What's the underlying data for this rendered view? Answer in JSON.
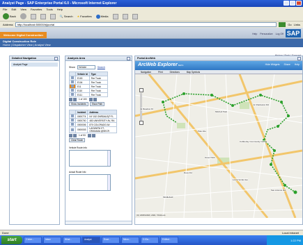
{
  "window": {
    "title": "Analyst Page - SAP Enterprise Portal 6.0 - Microsoft Internet Explorer"
  },
  "menu": [
    "File",
    "Edit",
    "View",
    "Favorites",
    "Tools",
    "Help"
  ],
  "toolbar": {
    "back": "Back",
    "search": "Search",
    "favorites": "Favorites",
    "media": "Media"
  },
  "address": {
    "label": "Address",
    "value": "http://localhost:50000/irj/portal",
    "go": "Go",
    "links": "Links"
  },
  "portal": {
    "welcome": "Welcome Digital Construction",
    "header_links": [
      "Help",
      "Personalize",
      "Log Off"
    ],
    "logo": "SAP",
    "crumb_title": "Digital Construction Role",
    "crumb_path": "Home | Dispatcher View | Analyst View",
    "history": "History | Back | Forward"
  },
  "detailed_nav": {
    "title": "Detailed Navigation",
    "item": "Analyst Page"
  },
  "analysis": {
    "title": "Analysis Area",
    "show_label": "Show",
    "show_value": "Vehicle",
    "search": "Search",
    "vehicle_headers": [
      "Vehicle Id",
      "Type"
    ],
    "vehicles": [
      [
        "E100",
        "Fire Truck"
      ],
      [
        "E104",
        "Fire Truck"
      ],
      [
        "E11",
        "Fire Truck"
      ],
      [
        "E110",
        "Fire Truck"
      ],
      [
        "E111",
        "Fire Truck"
      ]
    ],
    "vehicle_pager": "1 of 100",
    "vehicle_buttons": [
      "Show Incidents",
      "Show Path"
    ],
    "incident_headers": [
      "Incident",
      "Address"
    ],
    "incidents": [
      [
        "0000774",
        "NY 152 ONRDALE(P FL"
      ],
      [
        "0000700",
        "483 UNIVERSITY AV, RA"
      ],
      [
        "0000006",
        "870 COLORADO AV"
      ],
      [
        "0000003",
        "LAGUNITA CT-GRANADA @SECR"
      ]
    ],
    "incident_pager": "1 of 53",
    "incident_buttons": [
      "Clear Route"
    ],
    "vehicle_info_label": "Vehicle Route Info",
    "actual_info_label": "Actual Route Info"
  },
  "arcweb": {
    "panel_title": "Portal ArcWeb",
    "title": "ArcWeb Explorer",
    "beta": "BETA",
    "actions": [
      "Hide Widgets",
      "Share",
      "Help"
    ],
    "tabs": [
      "Navigation",
      "Print",
      "Directions",
      "Map Symbols"
    ],
    "labels": [
      "E Meadow Dr",
      "Mitchell Park",
      "Palo Alto",
      "Greer Park",
      "Ross Rd",
      "Loma Verde Ave",
      "Cubberley Community Center",
      "E Charleston Rd",
      "San Antonio Rd",
      "Middlefield"
    ],
    "copyright": "(C) 2008 ESRI, AND, TANA etc."
  },
  "status": {
    "left": "Done",
    "zone": "Local intranet"
  },
  "taskbar": {
    "start": "start",
    "buttons": [
      "2 Inter...",
      "Inbox",
      "Wind...",
      "Analyst",
      "Exce...",
      "Micro...",
      "C:\\Do...",
      "5 Wind..."
    ],
    "clock": "1:22 PM"
  },
  "colors": {
    "route": "#2aa02a",
    "titlebar": "#1a46b8",
    "crumb": "#3b68a8",
    "welcome": "#e88c20"
  }
}
